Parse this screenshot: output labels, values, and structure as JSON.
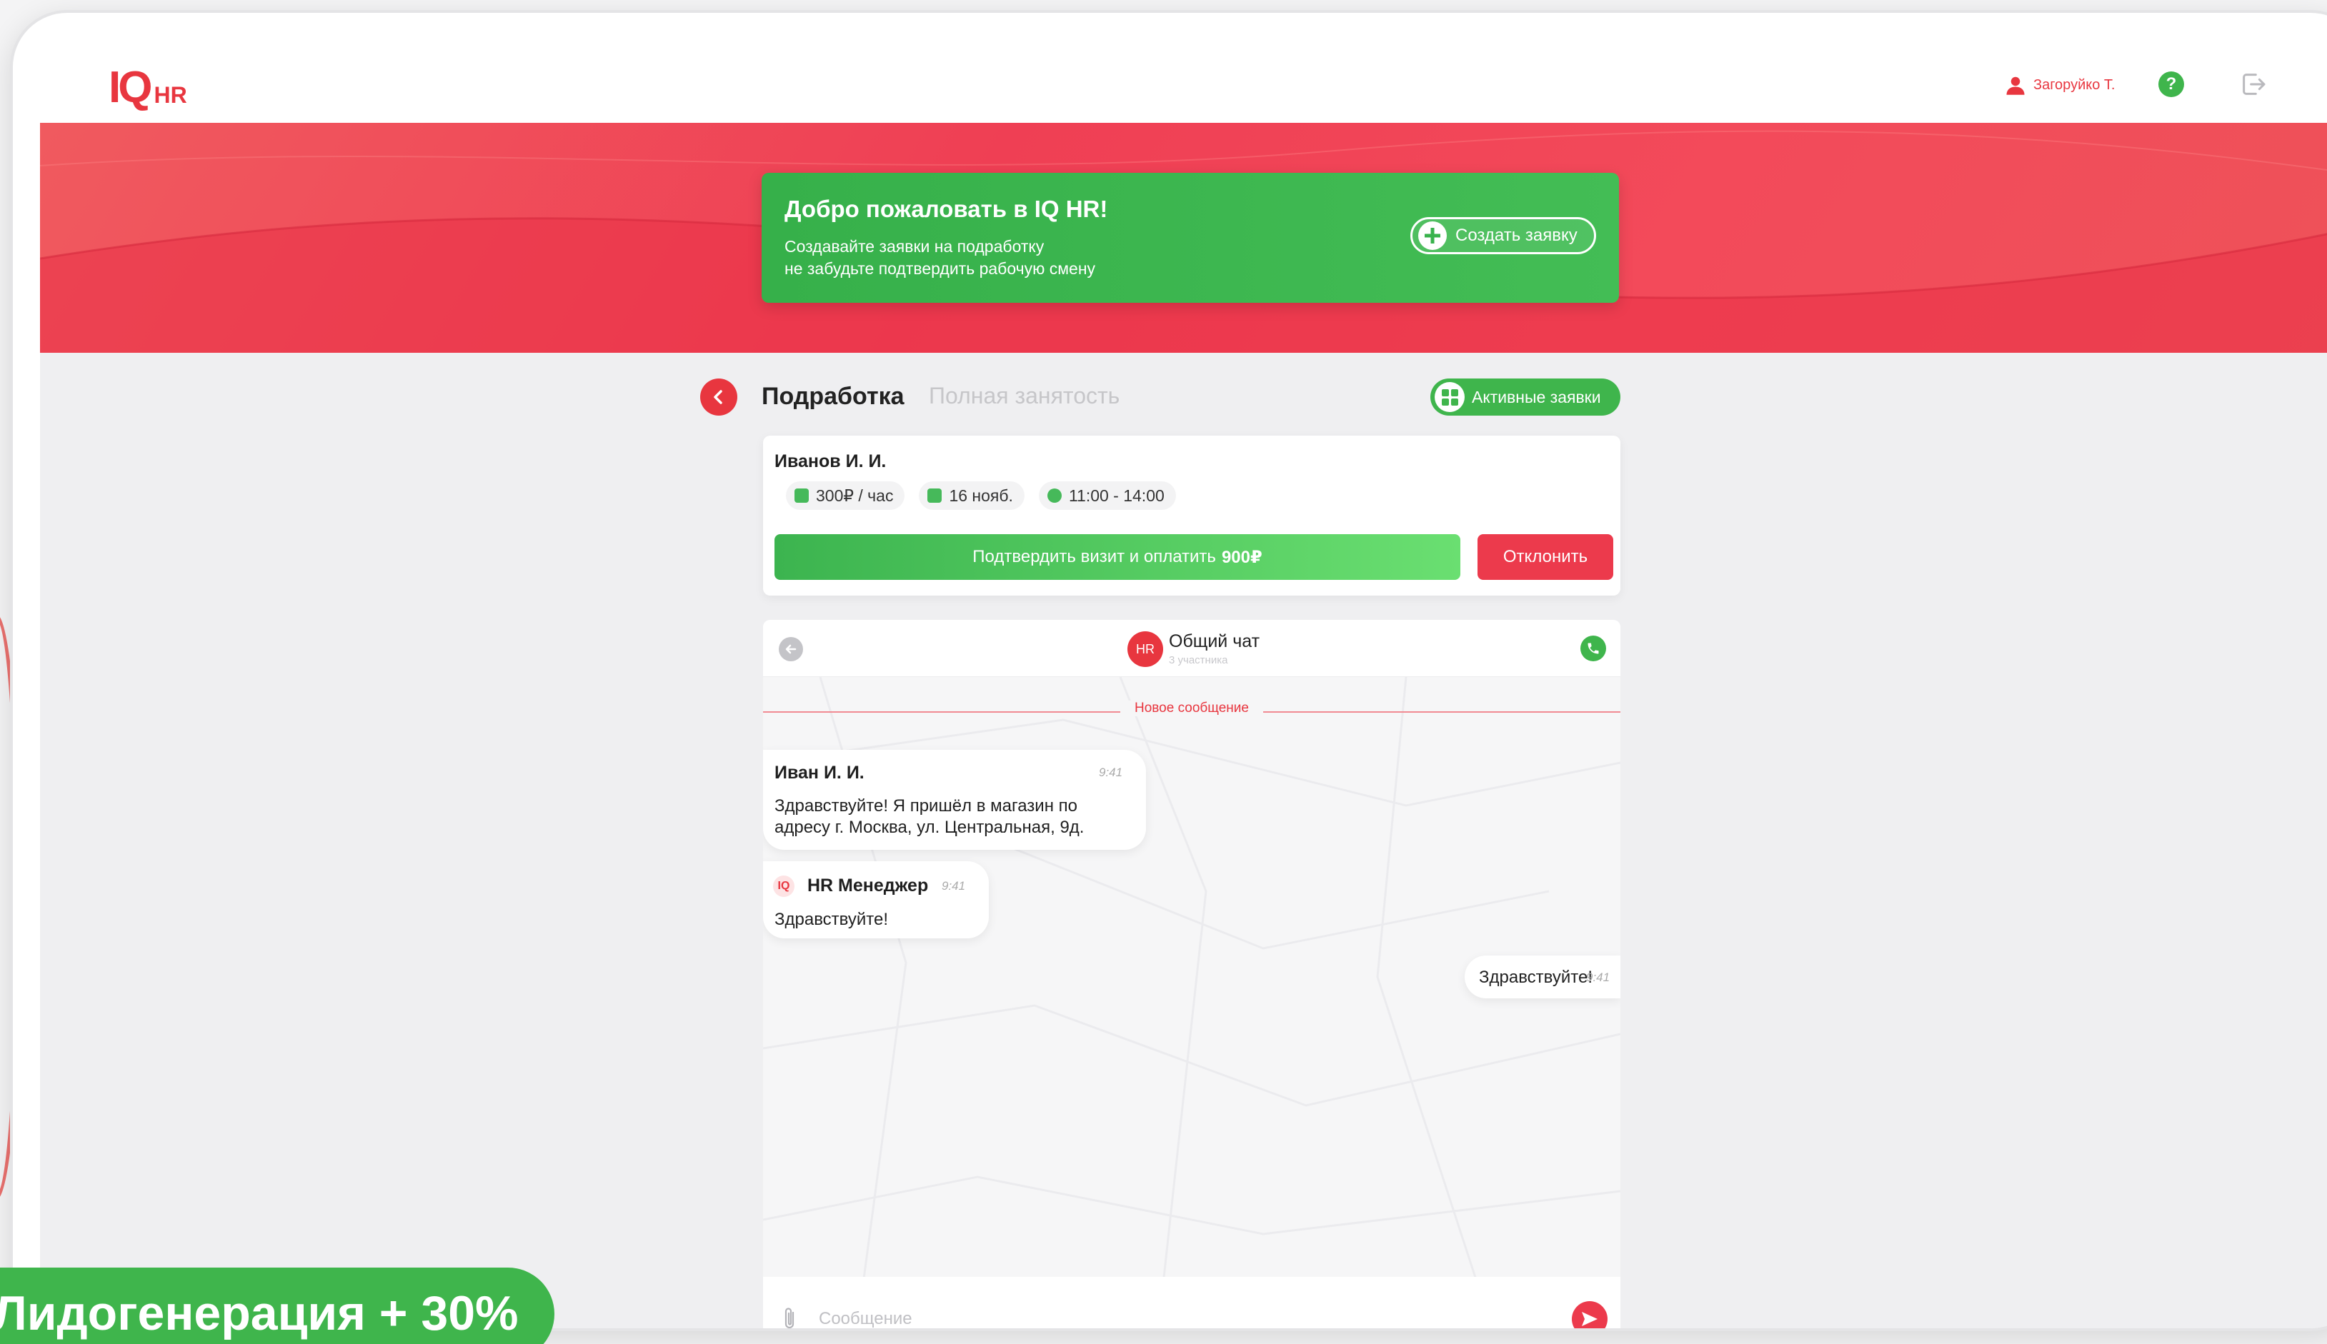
{
  "brand": {
    "logo_iq": "IQ",
    "logo_hr": "HR"
  },
  "header": {
    "user_name": "Загоруйко Т.",
    "help": "?"
  },
  "welcome": {
    "title": "Добро пожаловать в IQ HR!",
    "line1": "Создавайте заявки на подработку",
    "line2": "не забудьте подтвердить рабочую смену",
    "create_label": "Создать заявку"
  },
  "tabs": {
    "active": "Подработка",
    "inactive": "Полная занятость",
    "active_requests_label": "Активные заявки"
  },
  "request": {
    "name": "Иванов И. И.",
    "rate": "300₽ / час",
    "date": "16 нояб.",
    "time": "11:00 - 14:00",
    "confirm_label": "Подтвердить визит и оплатить",
    "confirm_amount": "900₽",
    "reject_label": "Отклонить"
  },
  "chat": {
    "avatar": "HR",
    "title": "Общий чат",
    "subtitle": "3 участника",
    "new_message_label": "Новое сообщение",
    "messages": [
      {
        "author": "Иван И. И.",
        "time": "9:41",
        "text": "Здравствуйте! Я пришёл в магазин по адресу г. Москва, ул. Центральная, 9д."
      },
      {
        "logo": "IQ",
        "author": "HR Менеджер",
        "time": "9:41",
        "text": "Здравствуйте!"
      },
      {
        "author": "",
        "time": "9:41",
        "text": "Здравствуйте!"
      }
    ],
    "input_placeholder": "Сообщение"
  },
  "promo": {
    "text": "Лидогенерация + 30%"
  },
  "colors": {
    "brand_red": "#e8363f",
    "green": "#3fb54c",
    "hero_red": "#ef3f54"
  }
}
